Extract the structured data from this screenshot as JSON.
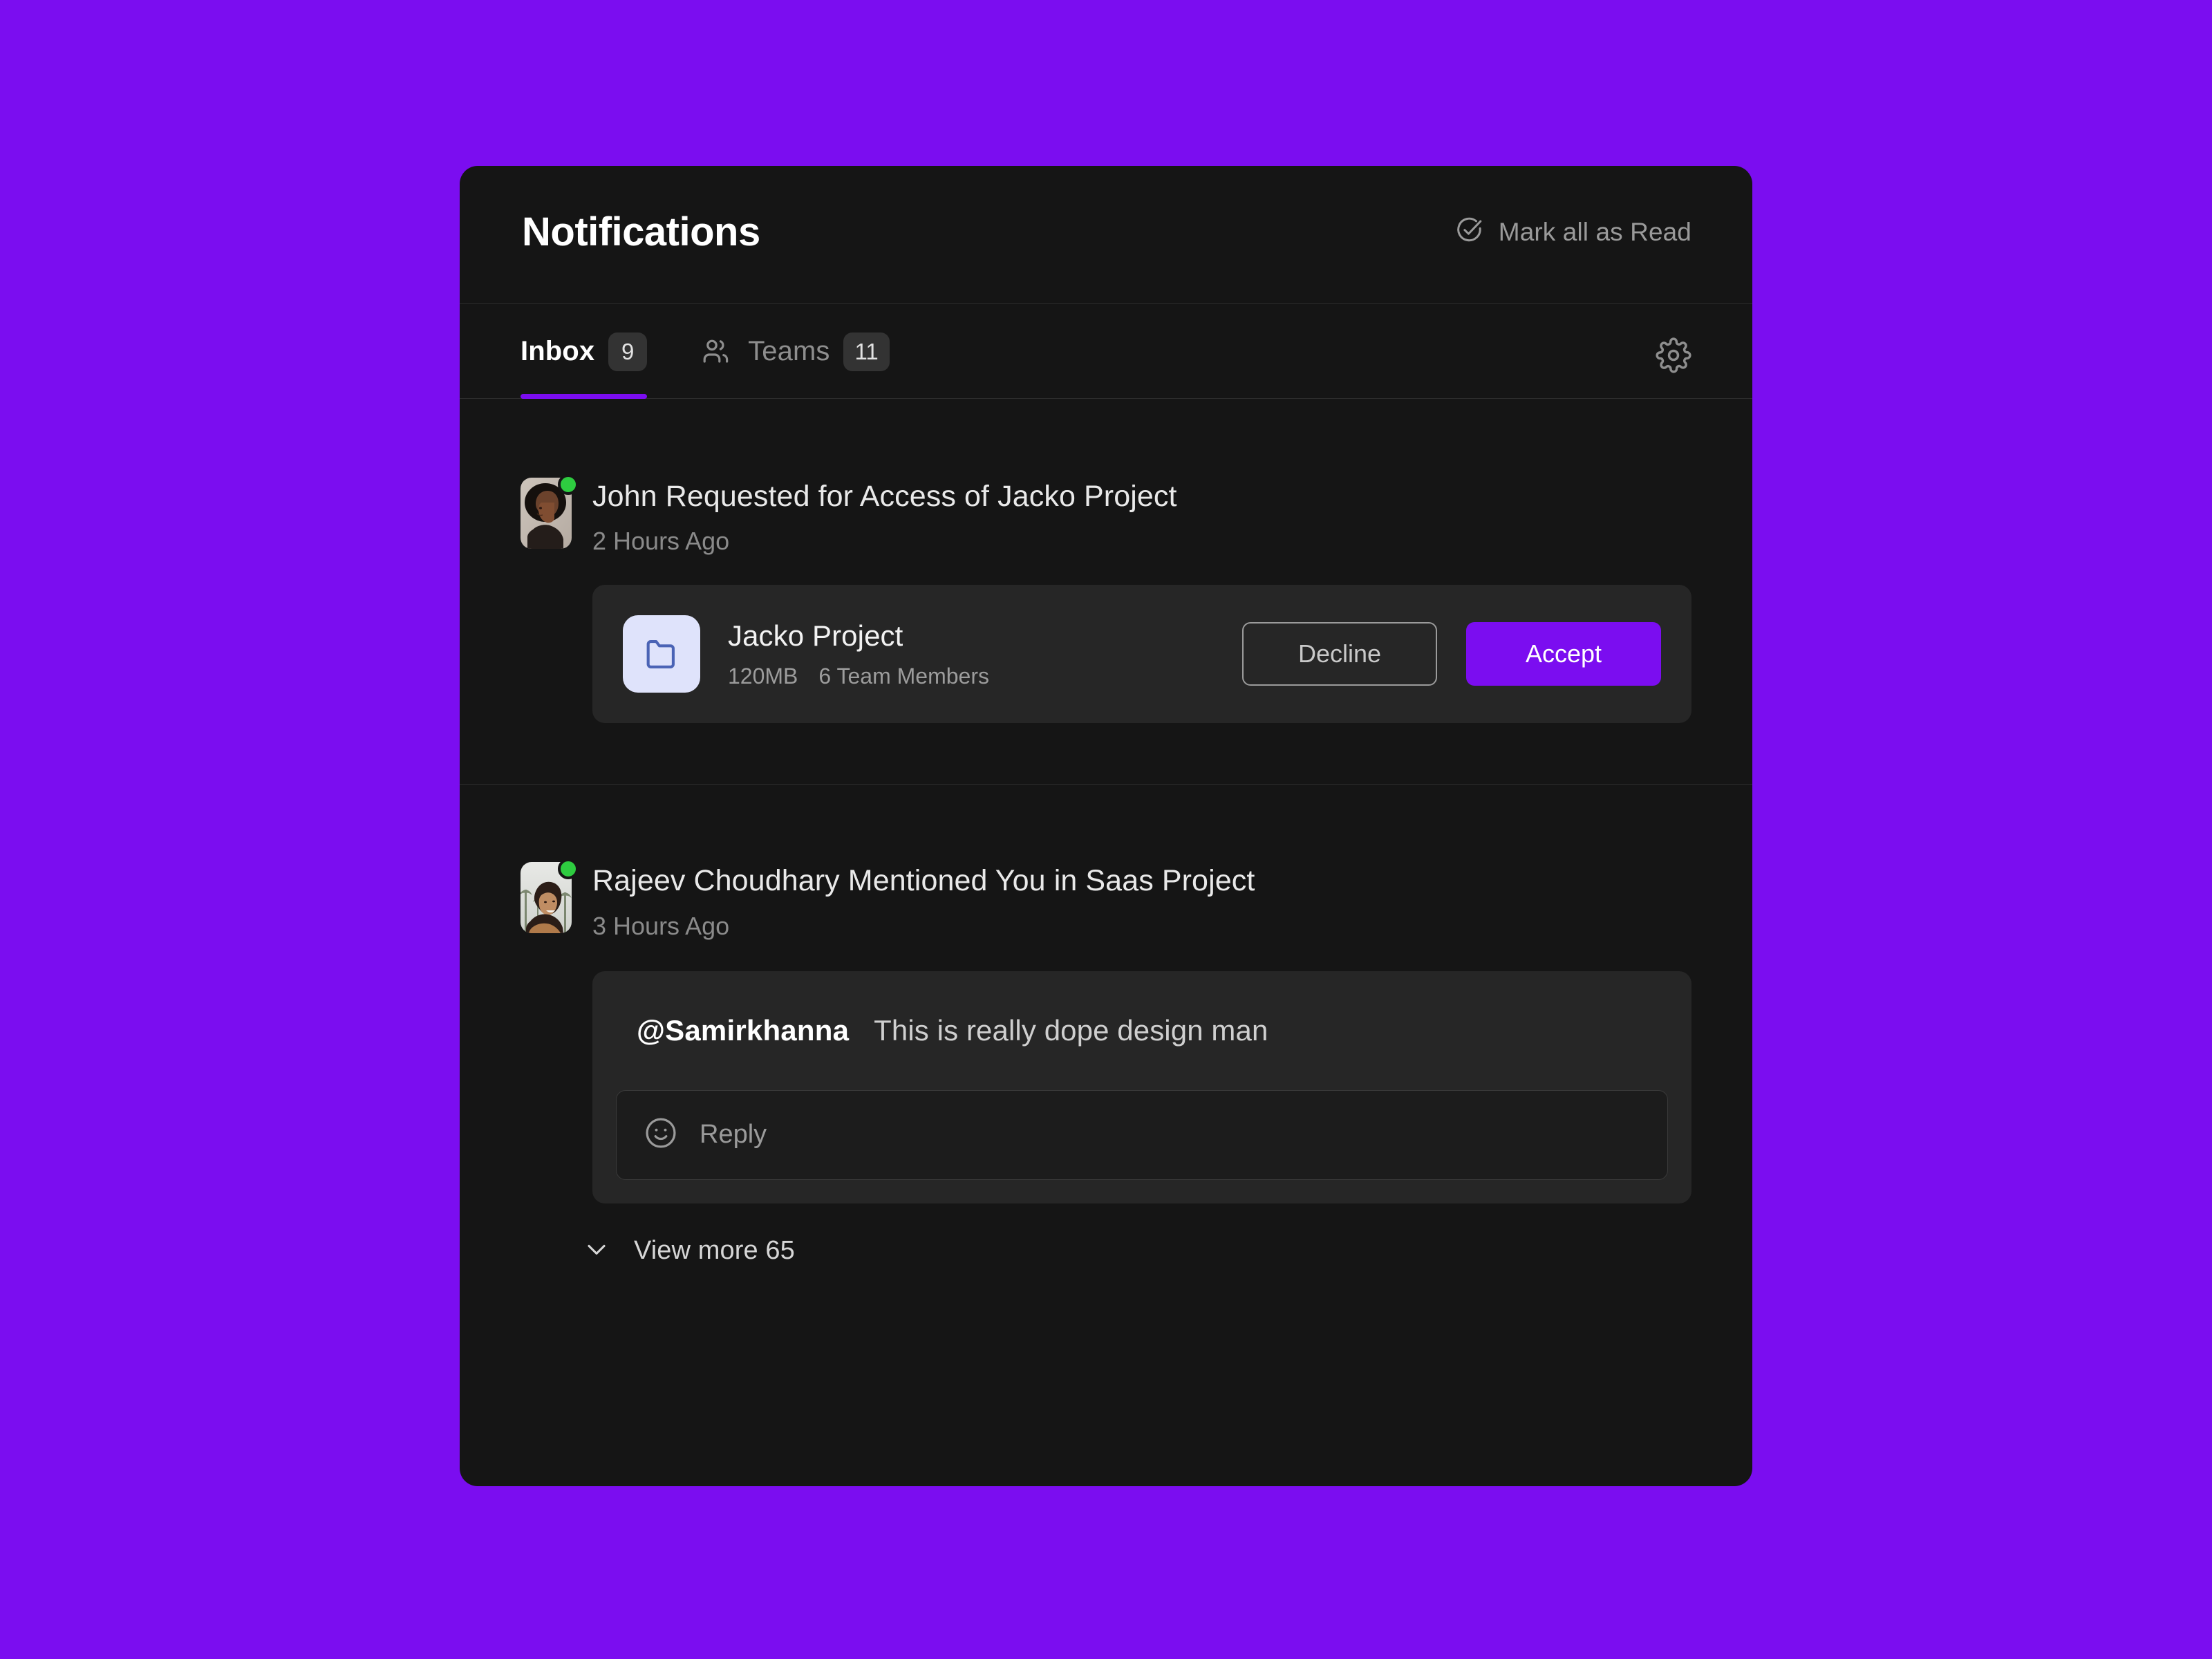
{
  "header": {
    "title": "Notifications",
    "mark_all_read": "Mark all as Read",
    "mark_all_read_icon": "check-circle-icon"
  },
  "tabs": {
    "settings_icon": "gear-icon",
    "items": [
      {
        "label": "Inbox",
        "badge": "9",
        "active": true,
        "icon": null
      },
      {
        "label": "Teams",
        "badge": "11",
        "active": false,
        "icon": "users-icon"
      }
    ]
  },
  "notifications": [
    {
      "title": "John Requested for Access of Jacko Project",
      "time": "2 Hours Ago",
      "avatar": "avatar-photo-john",
      "status": "online",
      "project": {
        "icon": "folder-icon",
        "name": "Jacko Project",
        "size": "120MB",
        "members": "6 Team Members",
        "decline_label": "Decline",
        "accept_label": "Accept"
      }
    },
    {
      "title": "Rajeev Choudhary Mentioned You in Saas Project",
      "time": "3 Hours Ago",
      "avatar": "avatar-photo-rajeev",
      "status": "online",
      "mention": {
        "handle": "@Samirkhanna",
        "message": "This is really dope design man",
        "reply_placeholder": "Reply",
        "reply_icon": "smiley-icon"
      }
    }
  ],
  "footer": {
    "view_more": "View more 65",
    "view_more_icon": "chevron-down-icon"
  },
  "colors": {
    "background": "#7b0df0",
    "panel": "#151515",
    "card": "#262626",
    "accent": "#7b0df0",
    "status_online": "#2ecc40",
    "folder_tile": "#dfe3fb",
    "folder_stroke": "#4a63b5"
  }
}
